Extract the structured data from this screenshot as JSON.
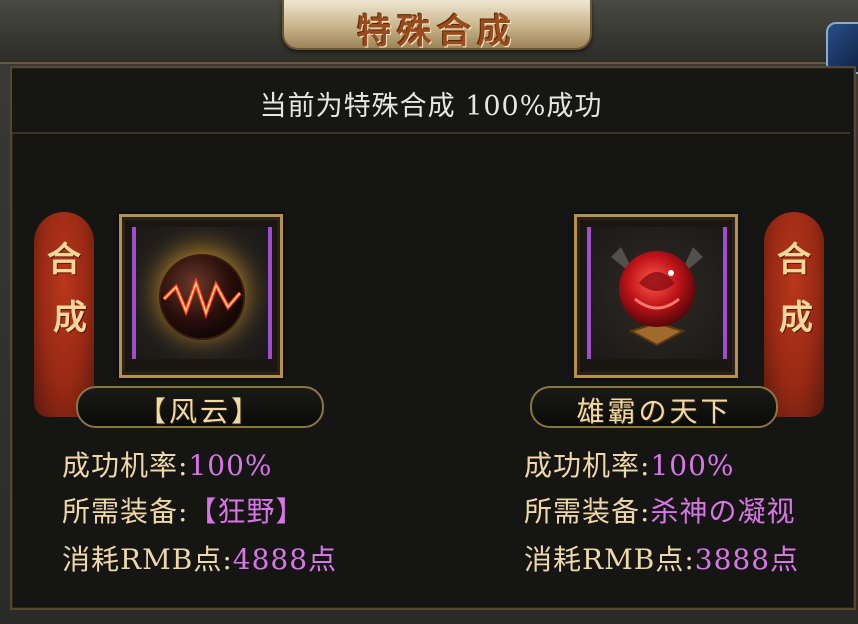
{
  "title": "特殊合成",
  "status": "当前为特殊合成 100%成功",
  "recipes": [
    {
      "banner_top": "合",
      "banner_bottom": "成",
      "icon": "fire-orb-icon",
      "name": "【风云】",
      "success_label": "成功机率:",
      "success_value": "100%",
      "required_label": "所需装备:",
      "required_value": "【狂野】",
      "cost_label": "消耗RMB点:",
      "cost_value": "4888点"
    },
    {
      "banner_top": "合",
      "banner_bottom": "成",
      "icon": "red-rose-icon",
      "name": "雄霸の天下",
      "success_label": "成功机率:",
      "success_value": "100%",
      "required_label": "所需装备:",
      "required_value": "杀神の凝视",
      "cost_label": "消耗RMB点:",
      "cost_value": "3888点"
    }
  ],
  "colors": {
    "label": "#efd8a6",
    "value": "#d876e6",
    "banner": "#b23218",
    "border": "#b7924e"
  }
}
